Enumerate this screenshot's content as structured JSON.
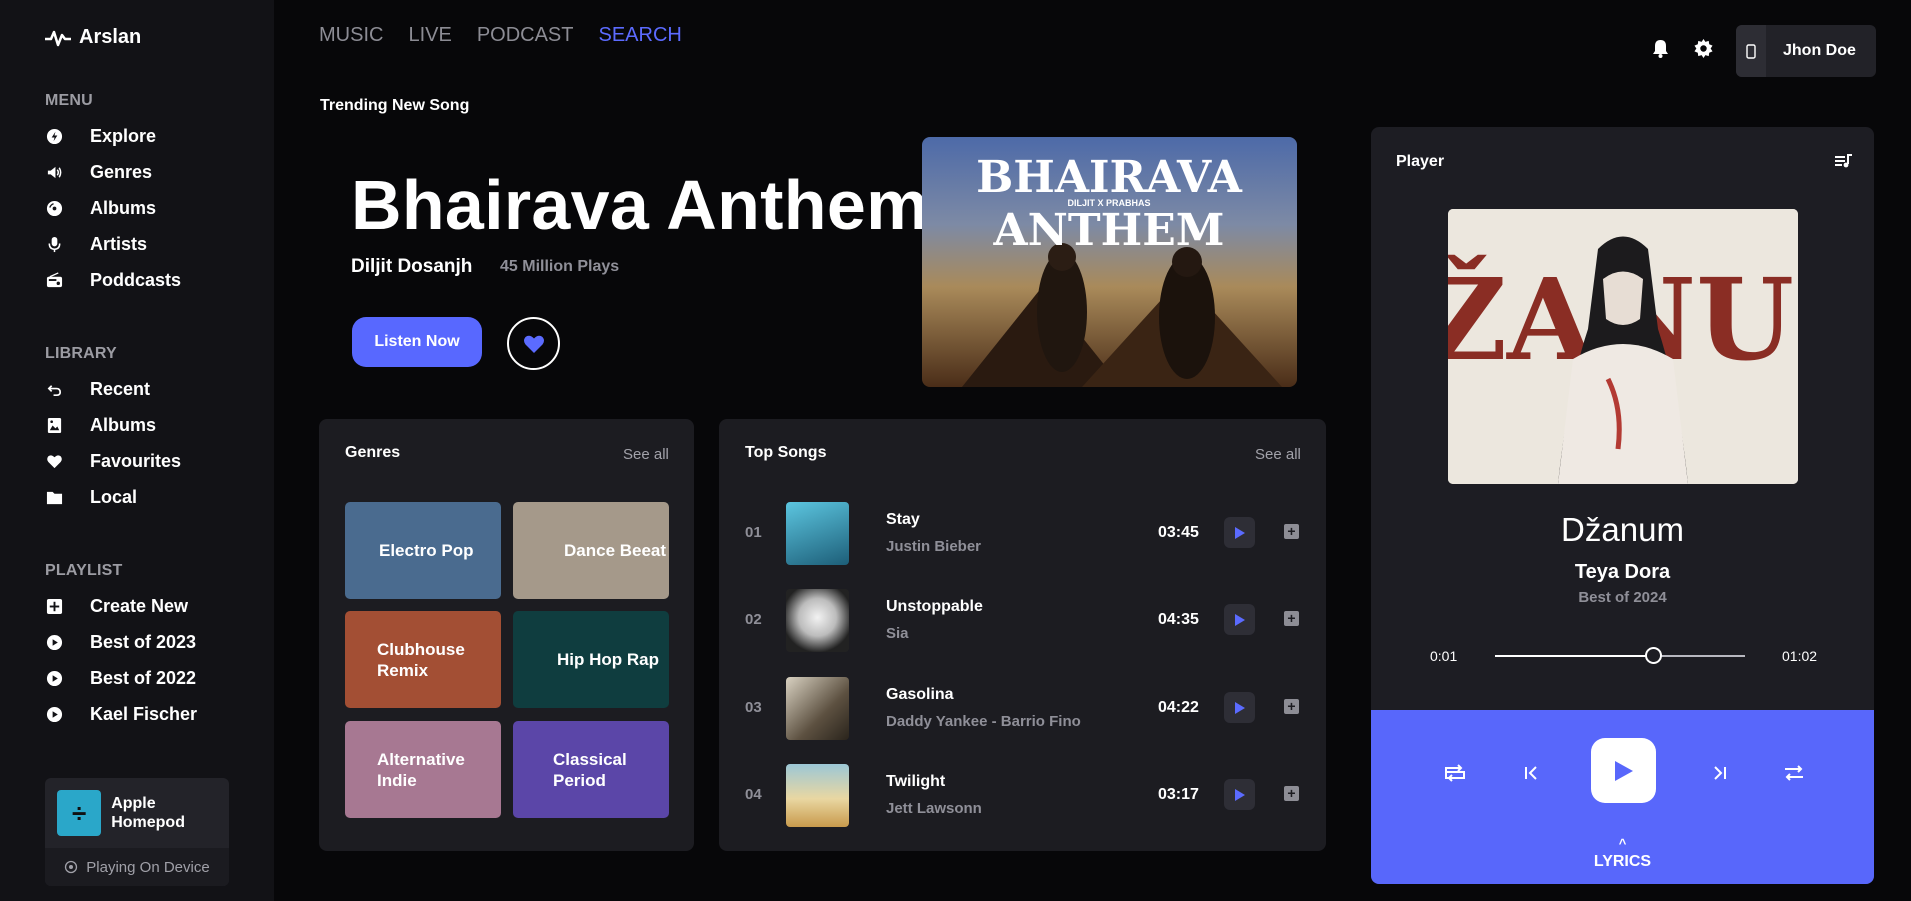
{
  "app": {
    "name": "Arslan"
  },
  "sidebar": {
    "menu_title": "MENU",
    "menu": [
      {
        "label": "Explore",
        "icon": "explore-icon"
      },
      {
        "label": "Genres",
        "icon": "speaker-icon"
      },
      {
        "label": "Albums",
        "icon": "disc-icon"
      },
      {
        "label": "Artists",
        "icon": "microphone-icon"
      },
      {
        "label": "Poddcasts",
        "icon": "radio-icon"
      }
    ],
    "library_title": "LIBRARY",
    "library": [
      {
        "label": "Recent",
        "icon": "undo-icon"
      },
      {
        "label": "Albums",
        "icon": "image-icon"
      },
      {
        "label": "Favourites",
        "icon": "heart-icon"
      },
      {
        "label": "Local",
        "icon": "folder-icon"
      }
    ],
    "playlist_title": "PLAYLIST",
    "playlist": [
      {
        "label": "Create New",
        "icon": "plus-square-icon"
      },
      {
        "label": "Best of 2023",
        "icon": "play-circle-icon"
      },
      {
        "label": "Best of 2022",
        "icon": "play-circle-icon"
      },
      {
        "label": "Kael Fischer",
        "icon": "play-circle-icon"
      }
    ],
    "device": {
      "name": "Apple Homepod",
      "status": "Playing On Device",
      "art_glyph": "÷"
    }
  },
  "topnav": {
    "tabs": [
      "MUSIC",
      "LIVE",
      "PODCAST",
      "SEARCH"
    ],
    "active": "SEARCH",
    "user": "Jhon Doe"
  },
  "hero": {
    "section_title": "Trending New Song",
    "title": "Bhairava Anthem",
    "artist": "Diljit Dosanjh",
    "plays": "45 Million Plays",
    "listen_label": "Listen Now",
    "art_text_line1": "BHAIRAVA",
    "art_text_line2": "ANTHEM",
    "art_subtext": "DILJIT X PRABHAS"
  },
  "genres": {
    "title": "Genres",
    "see_all": "See all",
    "items": [
      {
        "label": "Electro Pop",
        "color": "#4a6b8f"
      },
      {
        "label": "Dance Beeat",
        "color": "#a5998a"
      },
      {
        "label": "Clubhouse Remix",
        "color": "#a34f34"
      },
      {
        "label": "Hip Hop Rap",
        "color": "#0f3d3f"
      },
      {
        "label": "Alternative Indie",
        "color": "#a77892"
      },
      {
        "label": "Classical Period",
        "color": "#5b46a8"
      }
    ]
  },
  "top_songs": {
    "title": "Top Songs",
    "see_all": "See all",
    "items": [
      {
        "num": "01",
        "title": "Stay",
        "artist": "Justin Bieber",
        "duration": "03:45",
        "thumb": "#2f8fae"
      },
      {
        "num": "02",
        "title": "Unstoppable",
        "artist": "Sia",
        "duration": "04:35",
        "thumb": "#d8d8d8"
      },
      {
        "num": "03",
        "title": "Gasolina",
        "artist": "Daddy Yankee - Barrio Fino",
        "duration": "04:22",
        "thumb": "#8a7a62"
      },
      {
        "num": "04",
        "title": "Twilight",
        "artist": "Jett Lawsonn",
        "duration": "03:17",
        "thumb": "#e3c178"
      }
    ]
  },
  "player": {
    "title": "Player",
    "art_text": "DŽANUM",
    "song": "Džanum",
    "artist": "Teya Dora",
    "album": "Best of 2024",
    "elapsed": "0:01",
    "total": "01:02",
    "progress": 0.63,
    "lyrics_label": "LYRICS"
  },
  "colors": {
    "accent": "#5867fb",
    "sidebar": "#121216",
    "panel": "#1c1c21"
  }
}
